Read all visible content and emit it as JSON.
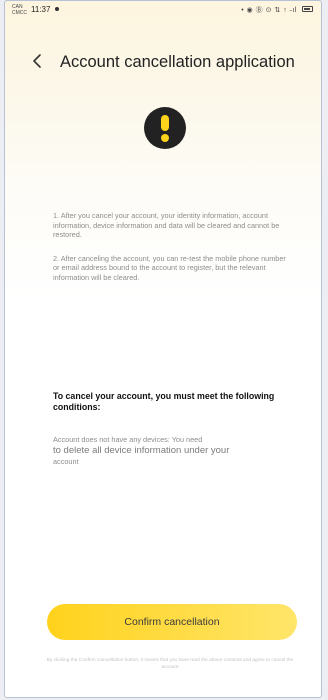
{
  "status_bar": {
    "carrier_top": "CAN",
    "carrier_bottom": "CMCC",
    "time": "11:37",
    "indicators": "• ◉ Ⓑ ⊙ ⇅ ↑ ˗ıl"
  },
  "header": {
    "back_icon": "chevron-left-icon",
    "title": "Account cancellation application"
  },
  "warning": {
    "icon": "exclamation-icon",
    "circle_color": "#222222",
    "mark_color": "#ffd21c"
  },
  "notes": [
    "1. After you cancel your account, your identity information, account information, device information and data will be cleared and cannot be restored.",
    "2. After canceling the account, you can re-test the mobile phone number or email address bound to the account to register, but the relevant information will be cleared."
  ],
  "conditions": {
    "title": "To cancel your account, you must meet the following conditions:",
    "text_small_before": "Account does not have any devices: You need",
    "text_large": "to delete all device information under your",
    "text_small_after": "account"
  },
  "confirm_button": {
    "label": "Confirm cancellation",
    "color_start": "#ffd21c",
    "color_end": "#ffe56a"
  },
  "footer_note": "By clicking the Confirm Cancellation button, it means that you have read the above contents and agree to cancel the account"
}
